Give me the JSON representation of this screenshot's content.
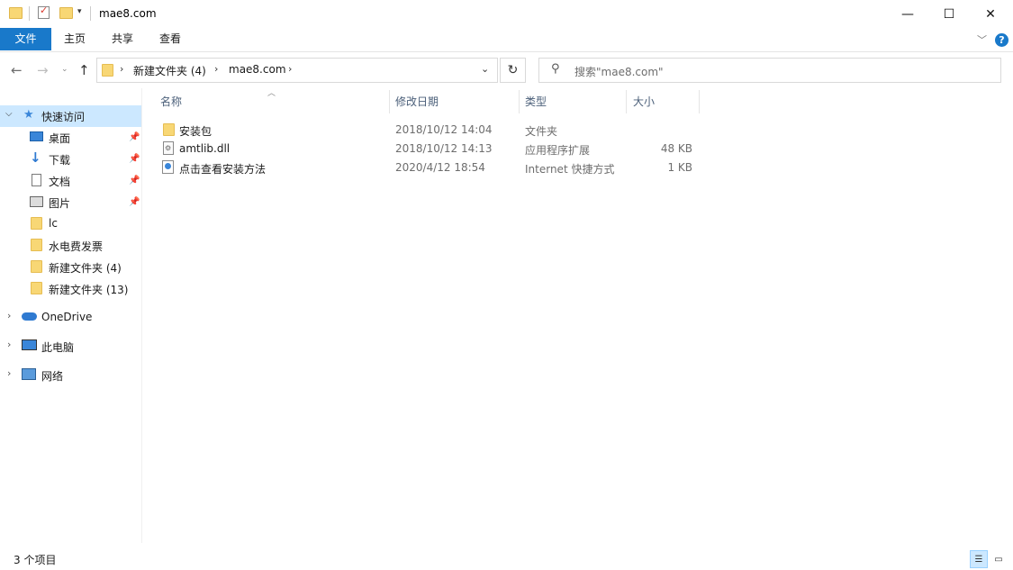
{
  "window": {
    "title": "mae8.com",
    "minimize": "—",
    "maximize": "☐",
    "close": "✕"
  },
  "ribbon": {
    "tabs": [
      "文件",
      "主页",
      "共享",
      "查看"
    ],
    "expand_icon": "chevron-down",
    "help": "?"
  },
  "address": {
    "breadcrumbs": [
      "新建文件夹 (4)",
      "mae8.com"
    ],
    "search_placeholder": "搜索\"mae8.com\""
  },
  "nav": {
    "quick_access": "快速访问",
    "items": [
      {
        "label": "桌面",
        "icon": "desktop-icon",
        "pinned": true
      },
      {
        "label": "下载",
        "icon": "download-icon",
        "pinned": true
      },
      {
        "label": "文档",
        "icon": "documents-icon",
        "pinned": true
      },
      {
        "label": "图片",
        "icon": "pictures-icon",
        "pinned": true
      },
      {
        "label": "lc",
        "icon": "folder-icon",
        "pinned": false
      },
      {
        "label": "水电费发票",
        "icon": "folder-icon",
        "pinned": false
      },
      {
        "label": "新建文件夹 (4)",
        "icon": "folder-icon",
        "pinned": false
      },
      {
        "label": "新建文件夹 (13)",
        "icon": "folder-icon",
        "pinned": false
      }
    ],
    "onedrive": "OneDrive",
    "this_pc": "此电脑",
    "network": "网络"
  },
  "columns": {
    "name": "名称",
    "date": "修改日期",
    "type": "类型",
    "size": "大小"
  },
  "files": [
    {
      "name": "安装包",
      "date": "2018/10/12 14:04",
      "type": "文件夹",
      "size": "",
      "icon": "folder-icon"
    },
    {
      "name": "amtlib.dll",
      "date": "2018/10/12 14:13",
      "type": "应用程序扩展",
      "size": "48 KB",
      "icon": "dll-file-icon"
    },
    {
      "name": "点击查看安装方法",
      "date": "2020/4/12 18:54",
      "type": "Internet 快捷方式",
      "size": "1 KB",
      "icon": "internet-shortcut-icon"
    }
  ],
  "status": {
    "item_count": "3 个项目"
  },
  "colors": {
    "file_tab": "#1979ca",
    "selected_nav": "#cce8ff",
    "folder": "#f8d775"
  }
}
